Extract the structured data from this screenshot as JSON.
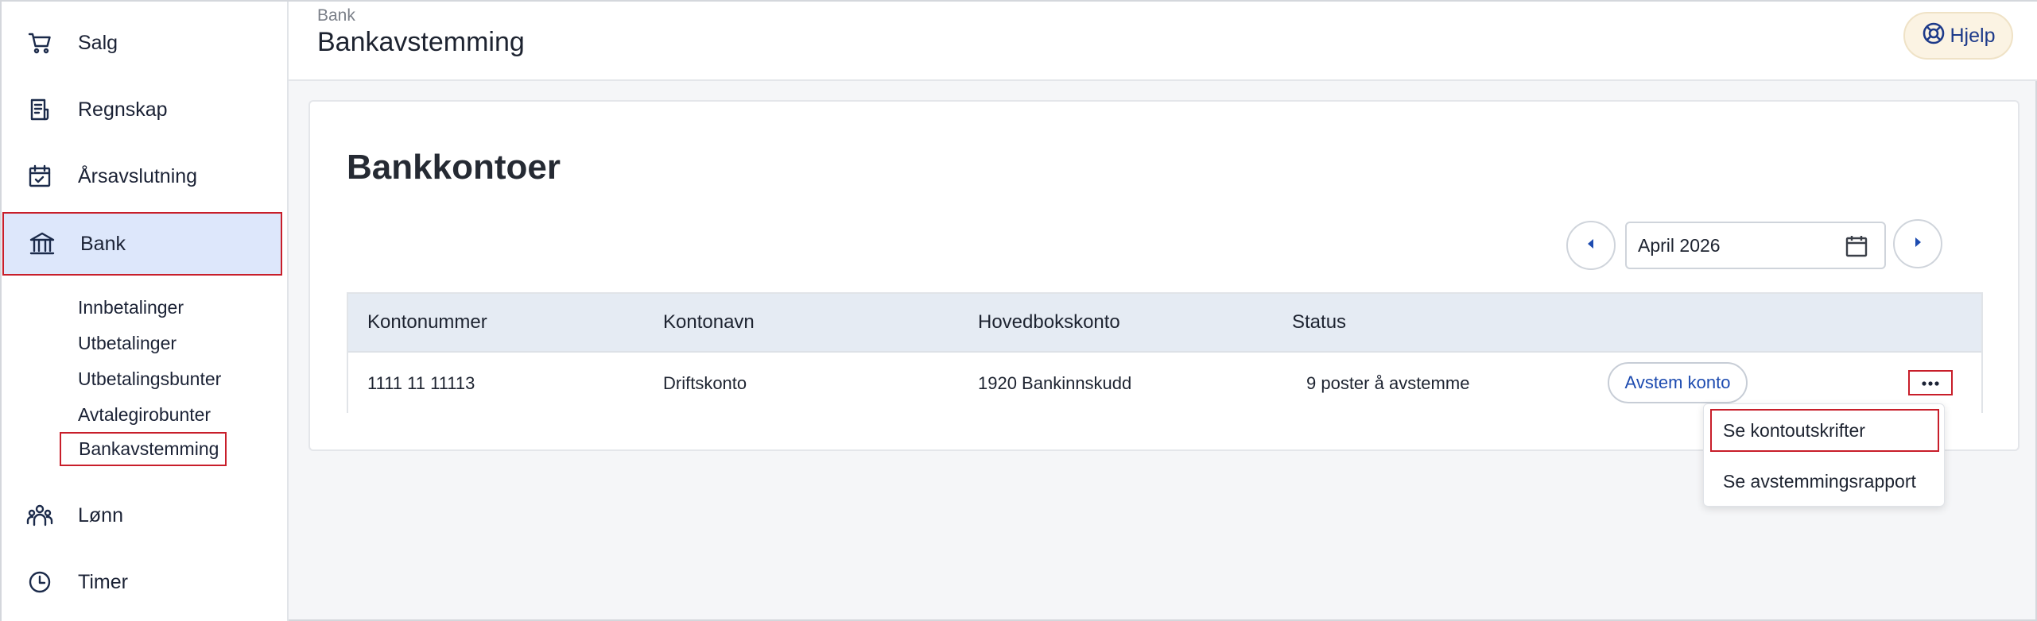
{
  "sidebar": {
    "items": [
      {
        "label": "Salg",
        "icon": "cart-icon"
      },
      {
        "label": "Regnskap",
        "icon": "ledger-icon"
      },
      {
        "label": "Årsavslutning",
        "icon": "calendar-check-icon"
      },
      {
        "label": "Bank",
        "icon": "bank-icon"
      },
      {
        "label": "Lønn",
        "icon": "people-icon"
      },
      {
        "label": "Timer",
        "icon": "clock-icon"
      }
    ],
    "bank_subitems": [
      "Innbetalinger",
      "Utbetalinger",
      "Utbetalingsbunter",
      "Avtalegirobunter",
      "Bankavstemming"
    ],
    "active_item": "Bank",
    "active_subitem": "Bankavstemming"
  },
  "header": {
    "breadcrumb": "Bank",
    "title": "Bankavstemming",
    "help_label": "Hjelp",
    "help_icon": "lifebuoy-icon"
  },
  "card": {
    "title": "Bankkontoer",
    "period": "April 2026",
    "prev_icon": "caret-left-icon",
    "next_icon": "caret-right-icon",
    "calendar_icon": "calendar-icon"
  },
  "table": {
    "columns": [
      "Kontonummer",
      "Kontonavn",
      "Hovedbokskonto",
      "Status"
    ],
    "rows": [
      {
        "kontonummer": "1111 11 11113",
        "kontonavn": "Driftskonto",
        "hovedbokskonto": "1920 Bankinnskudd",
        "status": "9 poster å avstemme",
        "action_label": "Avstem konto"
      }
    ]
  },
  "row_menu": {
    "items": [
      "Se kontoutskrifter",
      "Se avstemmingsrapport"
    ]
  },
  "colors": {
    "accent": "#1d4bb0",
    "active_bg": "#dde7fb",
    "highlight_border": "#c81e2a",
    "table_header_bg": "#e5ebf3"
  }
}
